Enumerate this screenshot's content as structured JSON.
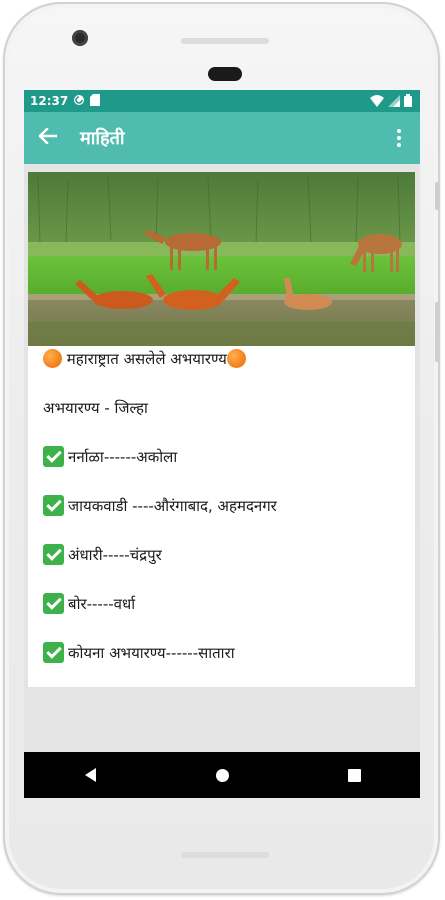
{
  "status_bar": {
    "time": "12:37",
    "icons": [
      "sync-icon",
      "sd-card-icon",
      "wifi-icon",
      "signal-icon",
      "battery-icon"
    ]
  },
  "app_bar": {
    "title": "माहिती",
    "back_icon": "arrow-left-icon",
    "menu_icon": "more-vert-icon"
  },
  "colors": {
    "status_bar": "#1f9a8a",
    "app_bar": "#4fbcaf",
    "check_emoji": "#3db24a",
    "orange_emoji": "#f5821f"
  },
  "content": {
    "heading": "महाराष्ट्रात असलेले अभयारण्य",
    "subheading": "अभयारण्य - जिल्हा",
    "items": [
      "नर्नाळा------अकोला",
      "जायकवाडी ----औरंगाबाद, अहमदनगर",
      "अंधारी-----चंद्रपुर",
      "बोर-----वर्धा",
      "कोयना अभयारण्य------सातारा"
    ]
  },
  "nav_bar": {
    "icons": [
      "back-triangle-icon",
      "home-circle-icon",
      "recents-square-icon"
    ]
  }
}
